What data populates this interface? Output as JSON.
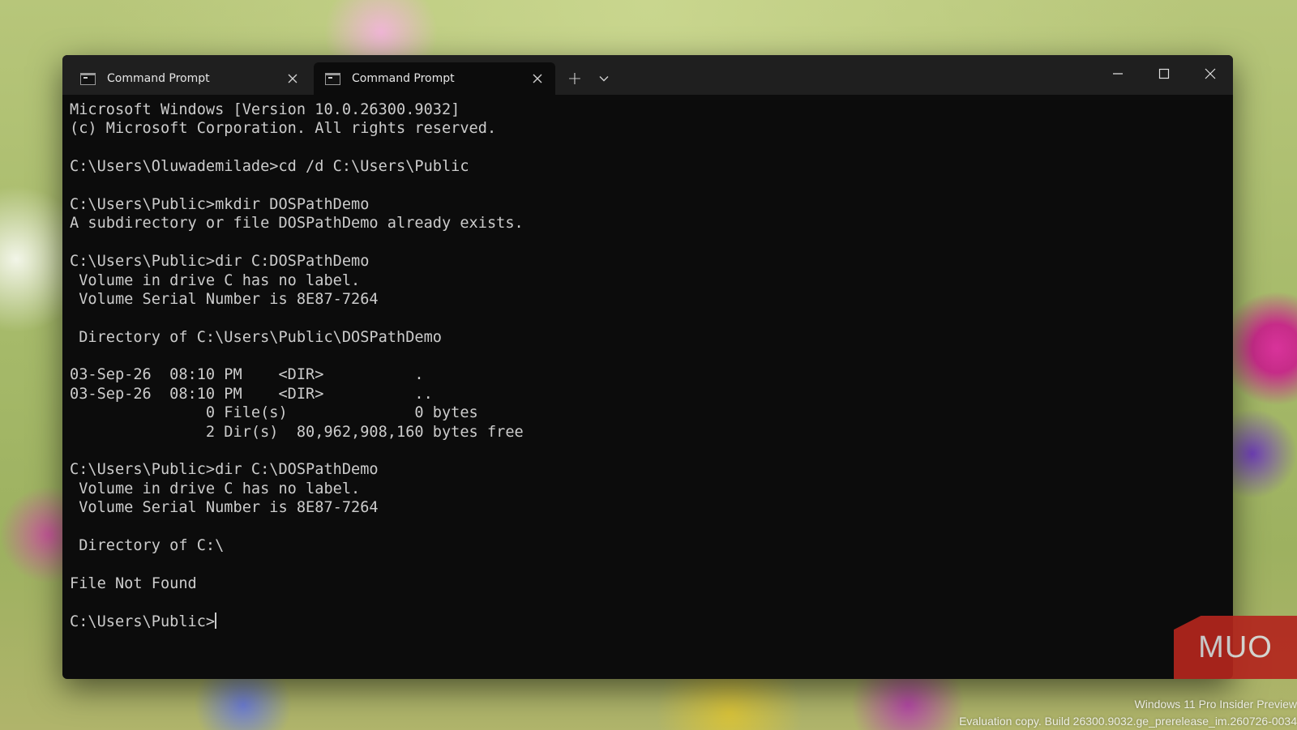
{
  "window": {
    "tabs": [
      {
        "title": "Command Prompt",
        "active": false
      },
      {
        "title": "Command Prompt",
        "active": true
      }
    ],
    "new_tab_symbol": "+",
    "icons": {
      "tab": "cmd-icon",
      "close_tab": "close-icon",
      "new_tab": "plus-icon",
      "dropdown": "chevron-down-icon",
      "minimize": "minimize-icon",
      "maximize": "maximize-icon",
      "close_window": "close-icon"
    }
  },
  "terminal": {
    "colors": {
      "background": "#0c0c0c",
      "text": "#cccccc",
      "titlebar": "#1f1f1f"
    },
    "lines": [
      "Microsoft Windows [Version 10.0.26300.9032]",
      "(c) Microsoft Corporation. All rights reserved.",
      "",
      "C:\\Users\\Oluwademilade>cd /d C:\\Users\\Public",
      "",
      "C:\\Users\\Public>mkdir DOSPathDemo",
      "A subdirectory or file DOSPathDemo already exists.",
      "",
      "C:\\Users\\Public>dir C:DOSPathDemo",
      " Volume in drive C has no label.",
      " Volume Serial Number is 8E87-7264",
      "",
      " Directory of C:\\Users\\Public\\DOSPathDemo",
      "",
      "03-Sep-26  08:10 PM    <DIR>          .",
      "03-Sep-26  08:10 PM    <DIR>          ..",
      "               0 File(s)              0 bytes",
      "               2 Dir(s)  80,962,908,160 bytes free",
      "",
      "C:\\Users\\Public>dir C:\\DOSPathDemo",
      " Volume in drive C has no label.",
      " Volume Serial Number is 8E87-7264",
      "",
      " Directory of C:\\",
      "",
      "File Not Found",
      ""
    ],
    "prompt": "C:\\Users\\Public>"
  },
  "watermark": {
    "logo_text": "MUO",
    "color": "#b3261e"
  },
  "os_watermark": {
    "line1": "Windows 11 Pro Insider Preview",
    "line2": "Evaluation copy. Build 26300.9032.ge_prerelease_im.260726-0034"
  }
}
